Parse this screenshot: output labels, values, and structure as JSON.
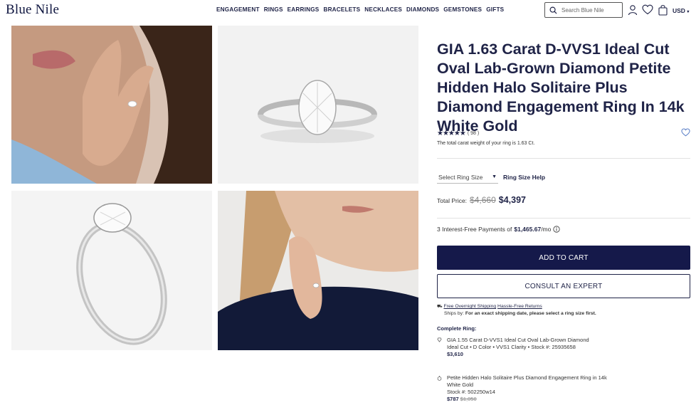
{
  "header": {
    "logo": "Blue Nile",
    "nav": [
      "ENGAGEMENT",
      "RINGS",
      "EARRINGS",
      "BRACELETS",
      "NECKLACES",
      "DIAMONDS",
      "GEMSTONES",
      "GIFTS"
    ],
    "search_placeholder": "Search Blue Nile",
    "currency": "USD"
  },
  "product": {
    "title": "GIA 1.63 Carat D-VVS1 Ideal Cut Oval Lab-Grown Diamond Petite Hidden Halo Solitaire Plus Diamond Engagement Ring In 14k White Gold",
    "stars": "★★★★★",
    "rating": 5,
    "review_count": "( 98 )",
    "carat_note": "The total carat weight of your ring is 1.63 Ct.",
    "ring_size_select": "Select Ring Size",
    "ring_size_help": "Ring Size Help",
    "price_label": "Total Price:",
    "price_old": "$4,660",
    "price_new": "$4,397",
    "installment_prefix": "3 Interest-Free Payments of",
    "installment_amount": "$1,465.67",
    "installment_suffix": "/mo",
    "add_to_cart": "ADD TO CART",
    "consult": "CONSULT AN EXPERT",
    "shipping_link_1": "Free Overnight Shipping",
    "shipping_link_2": "Hassle-Free Returns",
    "ships_by": "Ships by:",
    "ships_by_note": "For an exact shipping date, please select a ring size first."
  },
  "complete_ring": {
    "heading": "Complete Ring:",
    "items": [
      {
        "title": "GIA 1.55 Carat D-VVS1 Ideal Cut Oval Lab-Grown Diamond",
        "details": "Ideal Cut • D Color • VVS1 Clarity • Stock #: 25935658",
        "price": "$3,610",
        "price_old": ""
      },
      {
        "title": "Petite Hidden Halo Solitaire Plus Diamond Engagement Ring in 14k White Gold",
        "details": "Stock #: 502250w14",
        "price": "$787",
        "price_old": "$1,050"
      }
    ]
  },
  "colors": {
    "navy": "#15194a",
    "text": "#1f2347"
  }
}
